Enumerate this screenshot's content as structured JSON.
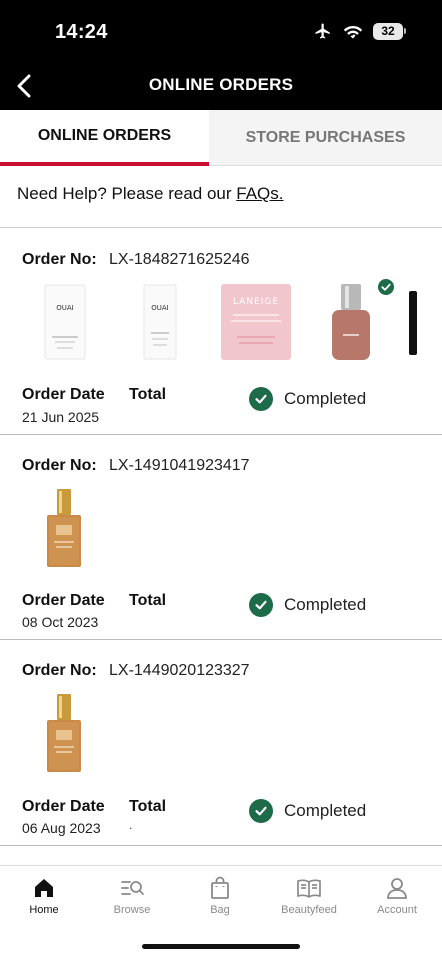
{
  "status_bar": {
    "time": "14:24",
    "battery": "32"
  },
  "header": {
    "title": "ONLINE ORDERS"
  },
  "tabs": [
    {
      "label": "ONLINE ORDERS"
    },
    {
      "label": "STORE PURCHASES"
    }
  ],
  "help": {
    "text": "Need Help? Please read our ",
    "link": "FAQs."
  },
  "orders": [
    {
      "order_no_label": "Order No:",
      "order_no": "LX-1848271625246",
      "date_label": "Order Date",
      "total_label": "Total",
      "date": "21 Jun 2025",
      "total": "",
      "status": "Completed",
      "products": [
        "OUAI",
        "OUAI",
        "LANEIGE",
        "",
        ""
      ]
    },
    {
      "order_no_label": "Order No:",
      "order_no": "LX-1491041923417",
      "date_label": "Order Date",
      "total_label": "Total",
      "date": "08 Oct 2023",
      "total": "",
      "status": "Completed"
    },
    {
      "order_no_label": "Order No:",
      "order_no": "LX-1449020123327",
      "date_label": "Order Date",
      "total_label": "Total",
      "date": "06 Aug 2023",
      "total": ".",
      "status": "Completed"
    }
  ],
  "bottom_nav": [
    {
      "label": "Home",
      "icon": "home-icon"
    },
    {
      "label": "Browse",
      "icon": "browse-icon"
    },
    {
      "label": "Bag",
      "icon": "bag-icon"
    },
    {
      "label": "Beautyfeed",
      "icon": "book-icon"
    },
    {
      "label": "Account",
      "icon": "account-icon"
    }
  ],
  "colors": {
    "accent": "#c8102e",
    "status_green": "#1e6b4a",
    "header_bg": "#000000"
  }
}
